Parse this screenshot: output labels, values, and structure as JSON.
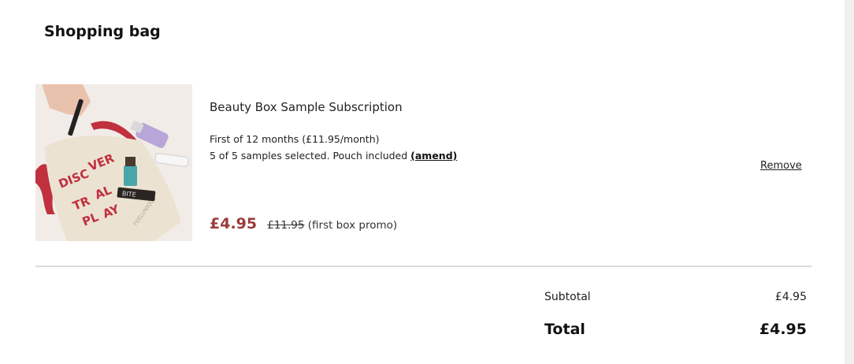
{
  "page": {
    "title": "Shopping bag"
  },
  "item": {
    "name": "Beauty Box Sample Subscription",
    "plan_text": "First of 12 months (£11.95/month)",
    "samples_text": "5 of 5 samples selected. Pouch included ",
    "amend_label": "(amend)",
    "price_current": "£4.95",
    "price_original": "£11.95",
    "price_note": " (first box promo)",
    "remove_label": "Remove",
    "image": {
      "pouch_text": [
        "DISC",
        "VER",
        "TR",
        "AL",
        "PL",
        "AY"
      ],
      "brand_text": "FEELUNIQUE",
      "lipstick_text": "BITE"
    }
  },
  "summary": {
    "subtotal_label": "Subtotal",
    "subtotal_value": "£4.95",
    "total_label": "Total",
    "total_value": "£4.95"
  },
  "colors": {
    "price_accent": "#9a3b3b",
    "divider": "#dadada",
    "ribbon": "#c0303f"
  }
}
